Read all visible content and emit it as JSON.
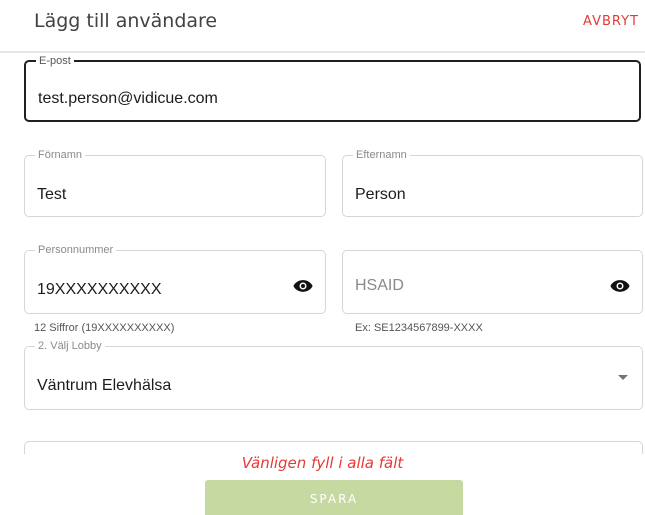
{
  "header": {
    "title": "Lägg till användare",
    "cancel_label": "AVBRYT"
  },
  "form": {
    "email": {
      "label": "E-post",
      "value": "test.person@vidicue.com"
    },
    "first_name": {
      "label": "Förnamn",
      "value": "Test"
    },
    "last_name": {
      "label": "Efternamn",
      "value": "Person"
    },
    "personnummer": {
      "label": "Personnummer",
      "value": "19XXXXXXXXXX",
      "hint": "12 Siffror (19XXXXXXXXXX)",
      "visibility_icon": "eye-icon"
    },
    "hsaid": {
      "placeholder": "HSAID",
      "hint": "Ex: SE1234567899-XXXX",
      "visibility_icon": "eye-icon"
    },
    "lobby": {
      "label": "2. Välj Lobby",
      "value": "Väntrum Elevhälsa",
      "dropdown_icon": "caret-down-icon"
    }
  },
  "footer": {
    "error_message": "Vänligen fyll i alla fält",
    "save_label": "SPARA"
  },
  "colors": {
    "accent_red": "#e53935",
    "save_disabled": "#c6d9a1"
  }
}
